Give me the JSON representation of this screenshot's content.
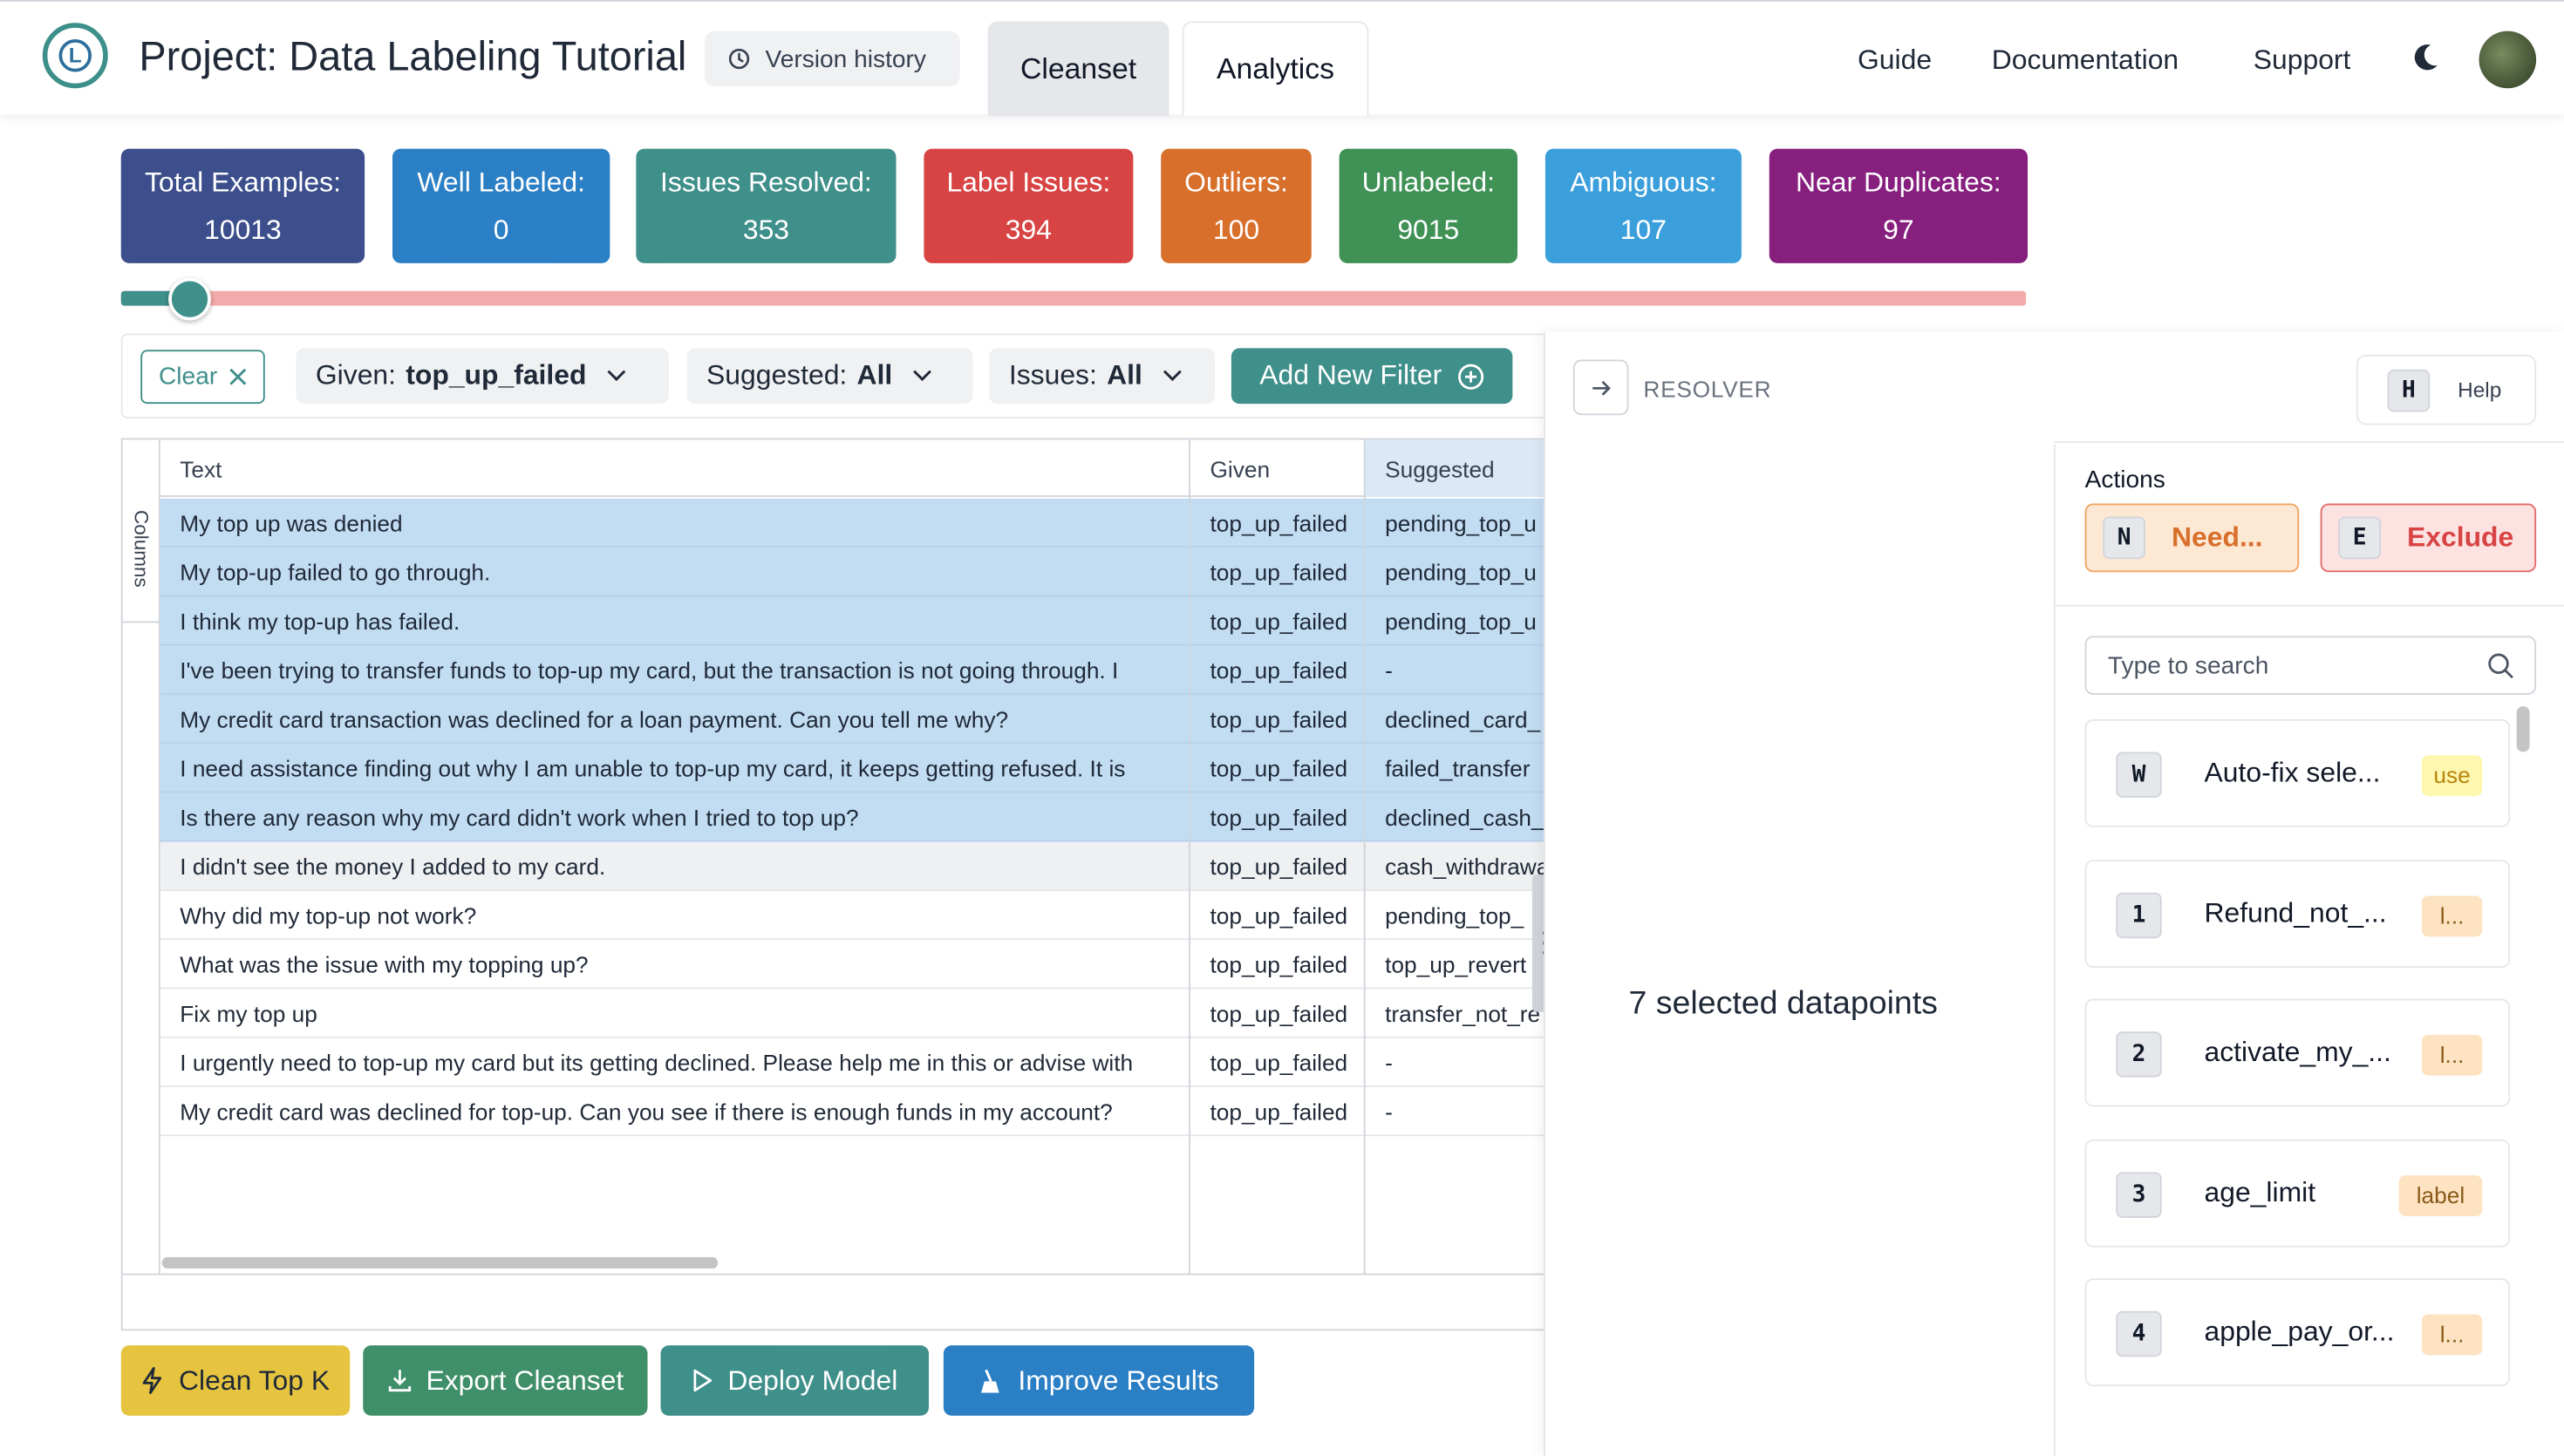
{
  "header": {
    "project_title": "Project: Data Labeling Tutorial",
    "version_history": "Version history",
    "tabs": [
      {
        "label": "Cleanset"
      },
      {
        "label": "Analytics"
      }
    ],
    "nav": [
      {
        "label": "Guide"
      },
      {
        "label": "Documentation"
      },
      {
        "label": "Support"
      }
    ]
  },
  "stats": [
    {
      "label": "Total Examples:",
      "value": "10013",
      "color": "#3c4f8c"
    },
    {
      "label": "Well Labeled:",
      "value": "0",
      "color": "#2b7fc4"
    },
    {
      "label": "Issues Resolved:",
      "value": "353",
      "color": "#3f8f8a"
    },
    {
      "label": "Label Issues:",
      "value": "394",
      "color": "#d84444"
    },
    {
      "label": "Outliers:",
      "value": "100",
      "color": "#d86f2b"
    },
    {
      "label": "Unlabeled:",
      "value": "9015",
      "color": "#3f9155"
    },
    {
      "label": "Ambiguous:",
      "value": "107",
      "color": "#3b9fdc"
    },
    {
      "label": "Near Duplicates:",
      "value": "97",
      "color": "#861f7e"
    }
  ],
  "progress": {
    "fraction": 0.035,
    "fill_color": "#3f8f8a",
    "track_color": "#f2aaaa"
  },
  "filters": {
    "clear_label": "Clear",
    "given": {
      "label": "Given:",
      "value": "top_up_failed"
    },
    "suggested": {
      "label": "Suggested:",
      "value": "All"
    },
    "issues": {
      "label": "Issues:",
      "value": "All"
    },
    "add_filter": "Add New Filter"
  },
  "table": {
    "columns_label": "Columns",
    "headers": {
      "text": "Text",
      "given": "Given",
      "suggested": "Suggested"
    },
    "rows": [
      {
        "text": "My top up was denied",
        "given": "top_up_failed",
        "suggested": "pending_top_u",
        "state": "selected"
      },
      {
        "text": "My top-up failed to go through.",
        "given": "top_up_failed",
        "suggested": "pending_top_u",
        "state": "selected"
      },
      {
        "text": "I think my top-up has failed.",
        "given": "top_up_failed",
        "suggested": "pending_top_u",
        "state": "selected"
      },
      {
        "text": "I've been trying to transfer funds to top-up my card, but the transaction is not going through. I",
        "given": "top_up_failed",
        "suggested": "-",
        "state": "selected"
      },
      {
        "text": "My credit card transaction was declined for a loan payment. Can you tell me why?",
        "given": "top_up_failed",
        "suggested": "declined_card_",
        "state": "selected"
      },
      {
        "text": "I need assistance finding out why I am unable to top-up my card, it keeps getting refused. It is",
        "given": "top_up_failed",
        "suggested": "failed_transfer",
        "state": "selected"
      },
      {
        "text": "Is there any reason why my card didn't work when I tried to top up?",
        "given": "top_up_failed",
        "suggested": "declined_cash_",
        "state": "selected"
      },
      {
        "text": "I didn't see the money I added to my card.",
        "given": "top_up_failed",
        "suggested": "cash_withdrawa",
        "state": "hover"
      },
      {
        "text": "Why did my top-up not work?",
        "given": "top_up_failed",
        "suggested": "pending_top_",
        "state": ""
      },
      {
        "text": "What was the issue with my topping up?",
        "given": "top_up_failed",
        "suggested": "top_up_revert",
        "state": ""
      },
      {
        "text": "Fix my top up",
        "given": "top_up_failed",
        "suggested": "transfer_not_re",
        "state": ""
      },
      {
        "text": "I urgently need to top-up my card but its getting declined. Please help me in this or advise with",
        "given": "top_up_failed",
        "suggested": "-",
        "state": ""
      },
      {
        "text": "My credit card was declined for top-up. Can you see if there is enough funds in my account?",
        "given": "top_up_failed",
        "suggested": "-",
        "state": ""
      }
    ]
  },
  "bottom_buttons": [
    {
      "label": "Clean Top K",
      "color": "#e6c440",
      "text_color": "#1f2937",
      "icon": "lightning-icon"
    },
    {
      "label": "Export Cleanset",
      "color": "#3f8f6a",
      "text_color": "#ffffff",
      "icon": "download-icon"
    },
    {
      "label": "Deploy Model",
      "color": "#3f8f8a",
      "text_color": "#ffffff",
      "icon": "play-icon"
    },
    {
      "label": "Improve Results",
      "color": "#2b7fc4",
      "text_color": "#ffffff",
      "icon": "broom-icon"
    }
  ],
  "resolver": {
    "title": "RESOLVER",
    "help_key": "H",
    "help_label": "Help",
    "selected_text": "7 selected datapoints",
    "actions_label": "Actions",
    "actions": [
      {
        "key": "N",
        "label": "Need...",
        "bg": "#fde8d4",
        "border": "#f0a561",
        "color": "#d86f2b"
      },
      {
        "key": "E",
        "label": "Exclude",
        "bg": "#fde2e2",
        "border": "#e36b6b",
        "color": "#d84444"
      }
    ],
    "search_placeholder": "Type to search",
    "labels": [
      {
        "key": "W",
        "name": "Auto-fix sele...",
        "tag": "use",
        "tag_bg": "#fdf7b0",
        "tag_color": "#b8860b"
      },
      {
        "key": "1",
        "name": "Refund_not_...",
        "tag": "l...",
        "tag_bg": "#fde3c2",
        "tag_color": "#8a5a1a"
      },
      {
        "key": "2",
        "name": "activate_my_...",
        "tag": "l...",
        "tag_bg": "#fde3c2",
        "tag_color": "#8a5a1a"
      },
      {
        "key": "3",
        "name": "age_limit",
        "tag": "label",
        "tag_bg": "#fde3c2",
        "tag_color": "#8a5a1a"
      },
      {
        "key": "4",
        "name": "apple_pay_or...",
        "tag": "l...",
        "tag_bg": "#fde3c2",
        "tag_color": "#8a5a1a"
      }
    ]
  }
}
